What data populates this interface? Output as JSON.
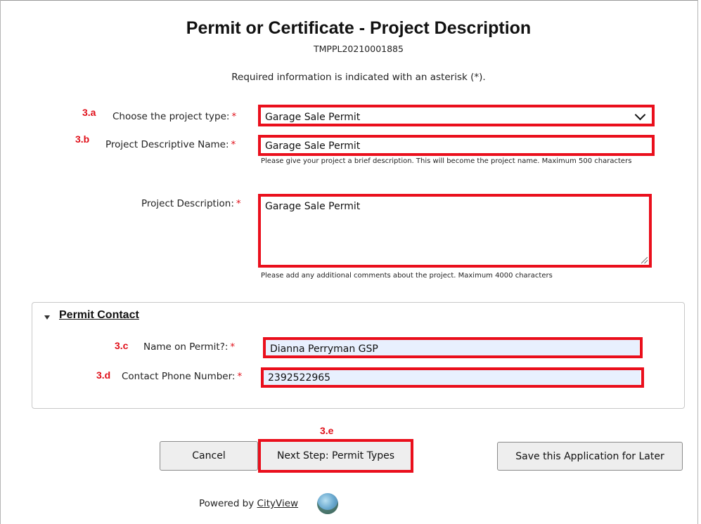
{
  "page": {
    "title": "Permit or Certificate - Project Description",
    "application_number": "TMPPL20210001885",
    "required_note": "Required information is indicated with an asterisk (*)."
  },
  "annotations": {
    "a": "3.a",
    "b": "3.b",
    "c": "3.c",
    "d": "3.d",
    "e": "3.e"
  },
  "colors": {
    "highlight": "#ea0f1c",
    "annotation": "#e0101a",
    "autofill_bg": "#e8f0fe"
  },
  "form": {
    "project_type": {
      "label": "Choose the project type:",
      "required_mark": "*",
      "value": "Garage Sale Permit"
    },
    "descriptive_name": {
      "label": "Project Descriptive Name:",
      "required_mark": "*",
      "value": "Garage Sale Permit",
      "help": "Please give your project a brief description. This will become the project name. Maximum 500 characters"
    },
    "description": {
      "label": "Project Description:",
      "required_mark": "*",
      "value": "Garage Sale Permit",
      "help": "Please add any additional comments about the project. Maximum 4000 characters"
    }
  },
  "contact": {
    "section_title": "Permit Contact",
    "name": {
      "label": "Name on Permit?:",
      "required_mark": "*",
      "value": "Dianna Perryman GSP"
    },
    "phone": {
      "label": "Contact Phone Number:",
      "required_mark": "*",
      "value": "2392522965"
    }
  },
  "buttons": {
    "cancel": "Cancel",
    "next": "Next Step: Permit Types",
    "save": "Save this Application for Later"
  },
  "footer": {
    "powered_by": "Powered by",
    "brand": "CityView"
  }
}
